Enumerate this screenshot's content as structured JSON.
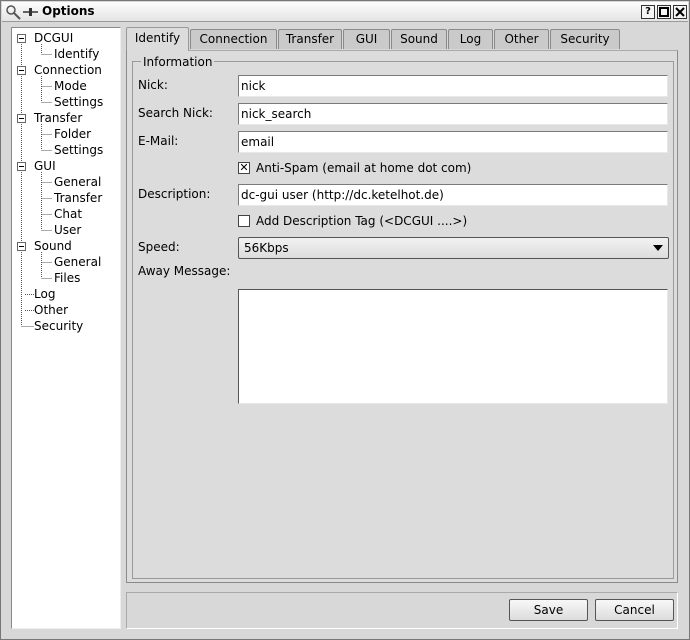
{
  "window": {
    "title": "Options",
    "buttons": {
      "help": "?",
      "maximize": "",
      "close": ""
    }
  },
  "tree": {
    "items": [
      {
        "label": "DCGUI",
        "level": 0
      },
      {
        "label": "Identify",
        "level": 1
      },
      {
        "label": "Connection",
        "level": 0
      },
      {
        "label": "Mode",
        "level": 1
      },
      {
        "label": "Settings",
        "level": 1
      },
      {
        "label": "Transfer",
        "level": 0
      },
      {
        "label": "Folder",
        "level": 1
      },
      {
        "label": "Settings",
        "level": 1
      },
      {
        "label": "GUI",
        "level": 0
      },
      {
        "label": "General",
        "level": 1
      },
      {
        "label": "Transfer",
        "level": 1
      },
      {
        "label": "Chat",
        "level": 1
      },
      {
        "label": "User",
        "level": 1
      },
      {
        "label": "Sound",
        "level": 0
      },
      {
        "label": "General",
        "level": 1
      },
      {
        "label": "Files",
        "level": 1
      },
      {
        "label": "Log",
        "level": 0
      },
      {
        "label": "Other",
        "level": 0
      },
      {
        "label": "Security",
        "level": 0
      }
    ]
  },
  "tabs": [
    {
      "label": "Identify",
      "active": true
    },
    {
      "label": "Connection"
    },
    {
      "label": "Transfer"
    },
    {
      "label": "GUI"
    },
    {
      "label": "Sound"
    },
    {
      "label": "Log"
    },
    {
      "label": "Other"
    },
    {
      "label": "Security"
    }
  ],
  "form": {
    "group_title": "Information",
    "nick_label": "Nick:",
    "nick_value": "nick",
    "search_nick_label": "Search Nick:",
    "search_nick_value": "nick_search",
    "email_label": "E-Mail:",
    "email_value": "email",
    "antispam_label": "Anti-Spam (email at home dot com)",
    "antispam_checked": true,
    "antispam_mark": "✕",
    "description_label": "Description:",
    "description_value": "dc-gui user (http://dc.ketelhot.de)",
    "desc_tag_label": "Add Description Tag (<DCGUI ....>)",
    "desc_tag_checked": false,
    "speed_label": "Speed:",
    "speed_value": "56Kbps",
    "away_label": "Away Message:",
    "away_value": ""
  },
  "buttons": {
    "save": "Save",
    "cancel": "Cancel"
  }
}
